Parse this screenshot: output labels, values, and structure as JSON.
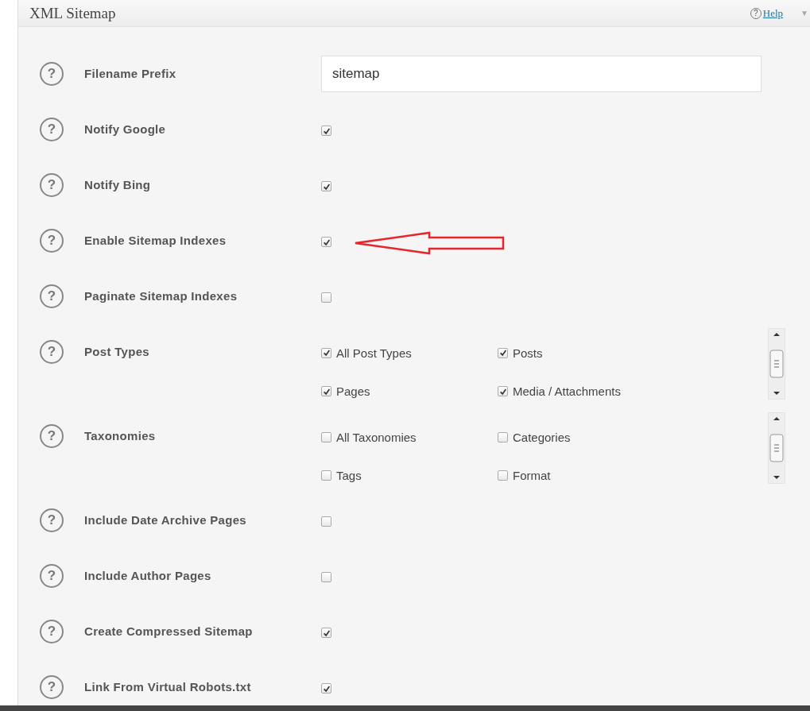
{
  "panel": {
    "title": "XML Sitemap",
    "help_icon": "?",
    "help_link": "Help",
    "collapse_arrow": "▼"
  },
  "rows": [
    {
      "kind": "text",
      "help": "?",
      "label": "Filename Prefix",
      "value": "sitemap"
    },
    {
      "kind": "checkbox",
      "help": "?",
      "label": "Notify Google",
      "checked": true,
      "highlighted": false
    },
    {
      "kind": "checkbox",
      "help": "?",
      "label": "Notify Bing",
      "checked": true,
      "highlighted": false
    },
    {
      "kind": "checkbox",
      "help": "?",
      "label": "Enable Sitemap Indexes",
      "checked": true,
      "highlighted": true
    },
    {
      "kind": "checkbox",
      "help": "?",
      "label": "Paginate Sitemap Indexes",
      "checked": false,
      "highlighted": false
    },
    {
      "kind": "checklist",
      "help": "?",
      "label": "Post Types",
      "options": [
        {
          "label": "All Post Types",
          "checked": true
        },
        {
          "label": "Posts",
          "checked": true
        },
        {
          "label": "Pages",
          "checked": true
        },
        {
          "label": "Media / Attachments",
          "checked": true
        }
      ]
    },
    {
      "kind": "checklist",
      "help": "?",
      "label": "Taxonomies",
      "options": [
        {
          "label": "All Taxonomies",
          "checked": false
        },
        {
          "label": "Categories",
          "checked": false
        },
        {
          "label": "Tags",
          "checked": false
        },
        {
          "label": "Format",
          "checked": false
        }
      ]
    },
    {
      "kind": "checkbox",
      "help": "?",
      "label": "Include Date Archive Pages",
      "checked": false,
      "highlighted": false
    },
    {
      "kind": "checkbox",
      "help": "?",
      "label": "Include Author Pages",
      "checked": false,
      "highlighted": false
    },
    {
      "kind": "checkbox",
      "help": "?",
      "label": "Create Compressed Sitemap",
      "checked": true,
      "highlighted": false
    },
    {
      "kind": "checkbox",
      "help": "?",
      "label": "Link From Virtual Robots.txt",
      "checked": true,
      "highlighted": false
    }
  ]
}
